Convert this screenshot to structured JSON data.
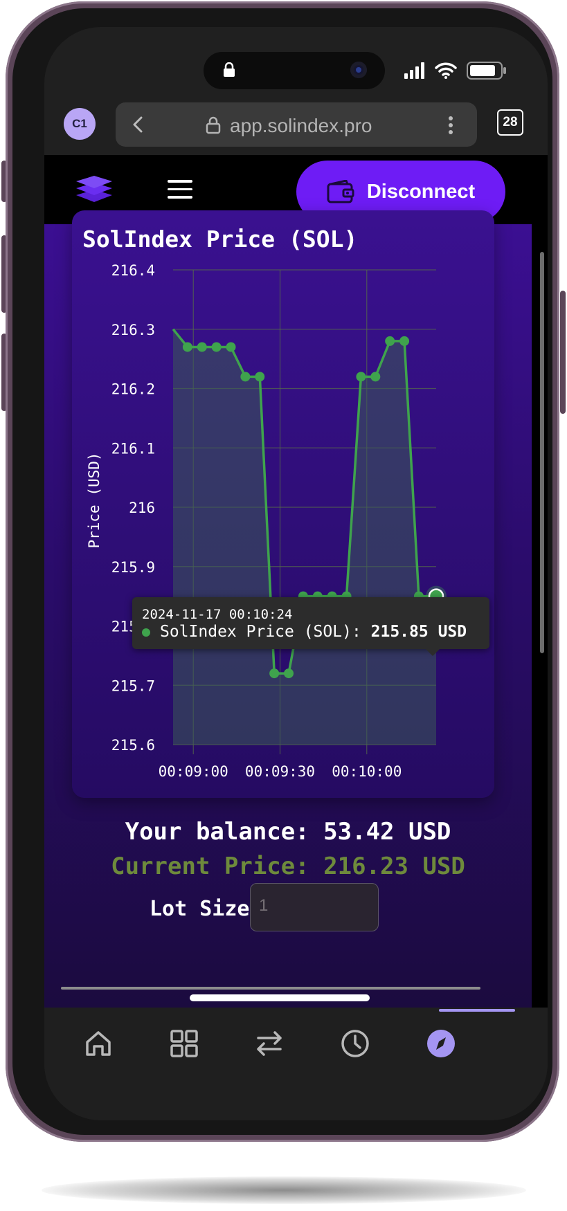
{
  "browser": {
    "avatar_initials": "C1",
    "url": "app.solindex.pro",
    "tab_count": "28"
  },
  "appbar": {
    "disconnect_label": "Disconnect",
    "accent_color": "#6e1cf5"
  },
  "chart_data": {
    "type": "line",
    "title": "SolIndex Price (SOL)",
    "ylabel": "Price (USD)",
    "xlabel": "",
    "ylim": [
      215.6,
      216.4
    ],
    "yticks": [
      "216.4",
      "216.3",
      "216.2",
      "216.1",
      "216",
      "215.9",
      "215.8",
      "215.7",
      "215.6"
    ],
    "xticks": [
      "00:09:00",
      "00:09:30",
      "00:10:00"
    ],
    "series": [
      {
        "name": "SolIndex Price (SOL)",
        "color": "#3fa34d",
        "x": [
          "00:08:53",
          "00:08:58",
          "00:09:03",
          "00:09:08",
          "00:09:13",
          "00:09:18",
          "00:09:23",
          "00:09:28",
          "00:09:33",
          "00:09:38",
          "00:09:43",
          "00:09:48",
          "00:09:53",
          "00:09:58",
          "00:10:03",
          "00:10:08",
          "00:10:13",
          "00:10:18",
          "00:10:23",
          "00:10:24"
        ],
        "y": [
          216.3,
          216.27,
          216.27,
          216.27,
          216.27,
          216.22,
          216.22,
          215.72,
          215.72,
          215.85,
          215.85,
          215.85,
          215.85,
          216.22,
          216.22,
          216.28,
          216.28,
          215.85,
          215.85,
          215.85
        ]
      }
    ],
    "highlighted_point": {
      "index": 19,
      "time": "2024-11-17 00:10:24",
      "value": "215.85 USD"
    },
    "grid": true
  },
  "tooltip": {
    "time": "2024-11-17 00:10:24",
    "series_label": "SolIndex Price (SOL): ",
    "value": "215.85 USD"
  },
  "account": {
    "balance": "Your balance: 53.42 USD",
    "current_price": "Current Price: 216.23 USD"
  },
  "trade": {
    "lot_size_label": "Lot Size",
    "lot_size_placeholder": "1"
  },
  "bottom_nav": [
    "home-icon",
    "grid-icon",
    "swap-icon",
    "clock-icon",
    "compass-icon"
  ]
}
